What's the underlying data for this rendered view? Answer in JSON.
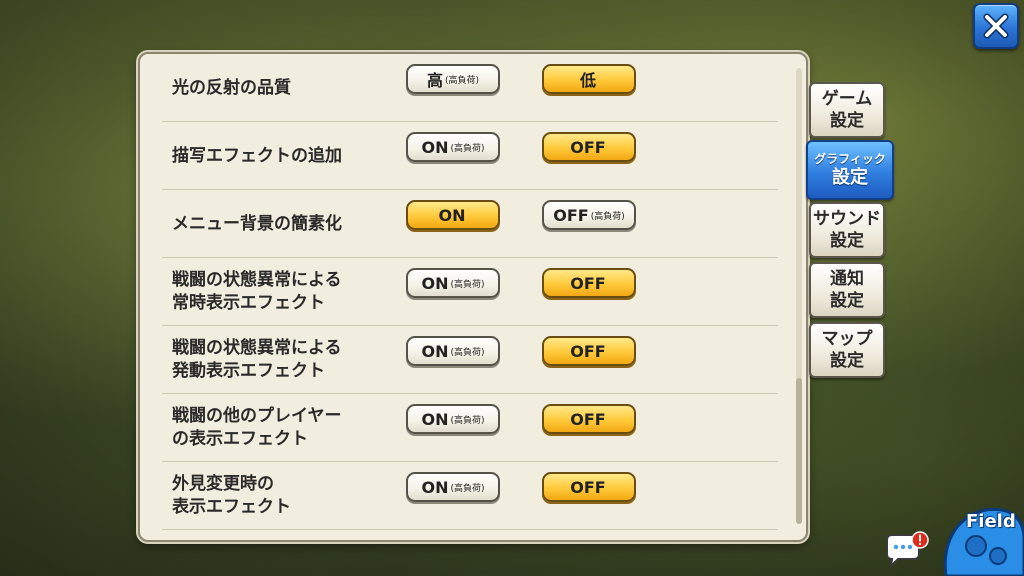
{
  "close_button": {
    "icon": "close-icon",
    "color": "#2a74d6"
  },
  "settings": [
    {
      "label": "光の反射の品質",
      "option1": "高",
      "option1_note": "(高負荷)",
      "option2": "低",
      "option2_note": "",
      "selected": 2
    },
    {
      "label": "描写エフェクトの追加",
      "option1": "ON",
      "option1_note": "(高負荷)",
      "option2": "OFF",
      "option2_note": "",
      "selected": 2
    },
    {
      "label": "メニュー背景の簡素化",
      "option1": "ON",
      "option1_note": "",
      "option2": "OFF",
      "option2_note": "(高負荷)",
      "selected": 1
    },
    {
      "label": "戦闘の状態異常による\n常時表示エフェクト",
      "option1": "ON",
      "option1_note": "(高負荷)",
      "option2": "OFF",
      "option2_note": "",
      "selected": 2
    },
    {
      "label": "戦闘の状態異常による\n発動表示エフェクト",
      "option1": "ON",
      "option1_note": "(高負荷)",
      "option2": "OFF",
      "option2_note": "",
      "selected": 2
    },
    {
      "label": "戦闘の他のプレイヤー\nの表示エフェクト",
      "option1": "ON",
      "option1_note": "(高負荷)",
      "option2": "OFF",
      "option2_note": "",
      "selected": 2
    },
    {
      "label": "外見変更時の\n表示エフェクト",
      "option1": "ON",
      "option1_note": "(高負荷)",
      "option2": "OFF",
      "option2_note": "",
      "selected": 2
    }
  ],
  "tabs": [
    {
      "line1": "ゲーム",
      "line2": "設定"
    },
    {
      "line1": "グラフィック",
      "line2": "設定"
    },
    {
      "line1": "サウンド",
      "line2": "設定"
    },
    {
      "line1": "通知",
      "line2": "設定"
    },
    {
      "line1": "マップ",
      "line2": "設定"
    }
  ],
  "active_tab": 1,
  "field_badge": {
    "text": "Field"
  },
  "colors": {
    "accent_on": "#ffc93a",
    "tab_active": "#2f7fe0",
    "panel": "#f2eedf"
  }
}
